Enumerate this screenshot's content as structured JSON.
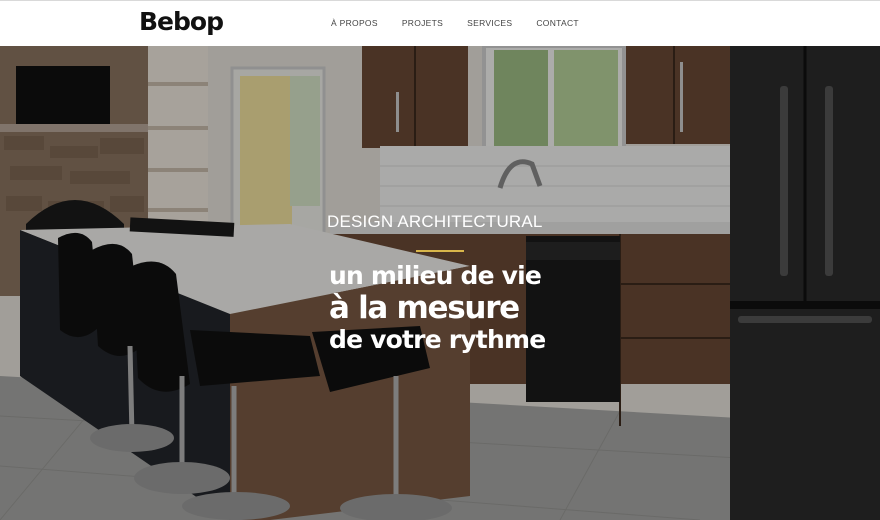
{
  "header": {
    "logo": "Bebop",
    "nav": [
      {
        "label": "À PROPOS"
      },
      {
        "label": "PROJETS"
      },
      {
        "label": "SERVICES"
      },
      {
        "label": "CONTACT"
      }
    ]
  },
  "hero": {
    "eyebrow": "DESIGN ARCHITECTURAL",
    "headline": [
      "un milieu de vie",
      "à la mesure",
      "de votre rythme"
    ],
    "accent_color": "#d9b64a",
    "image_description_icon": "kitchen-photo"
  }
}
